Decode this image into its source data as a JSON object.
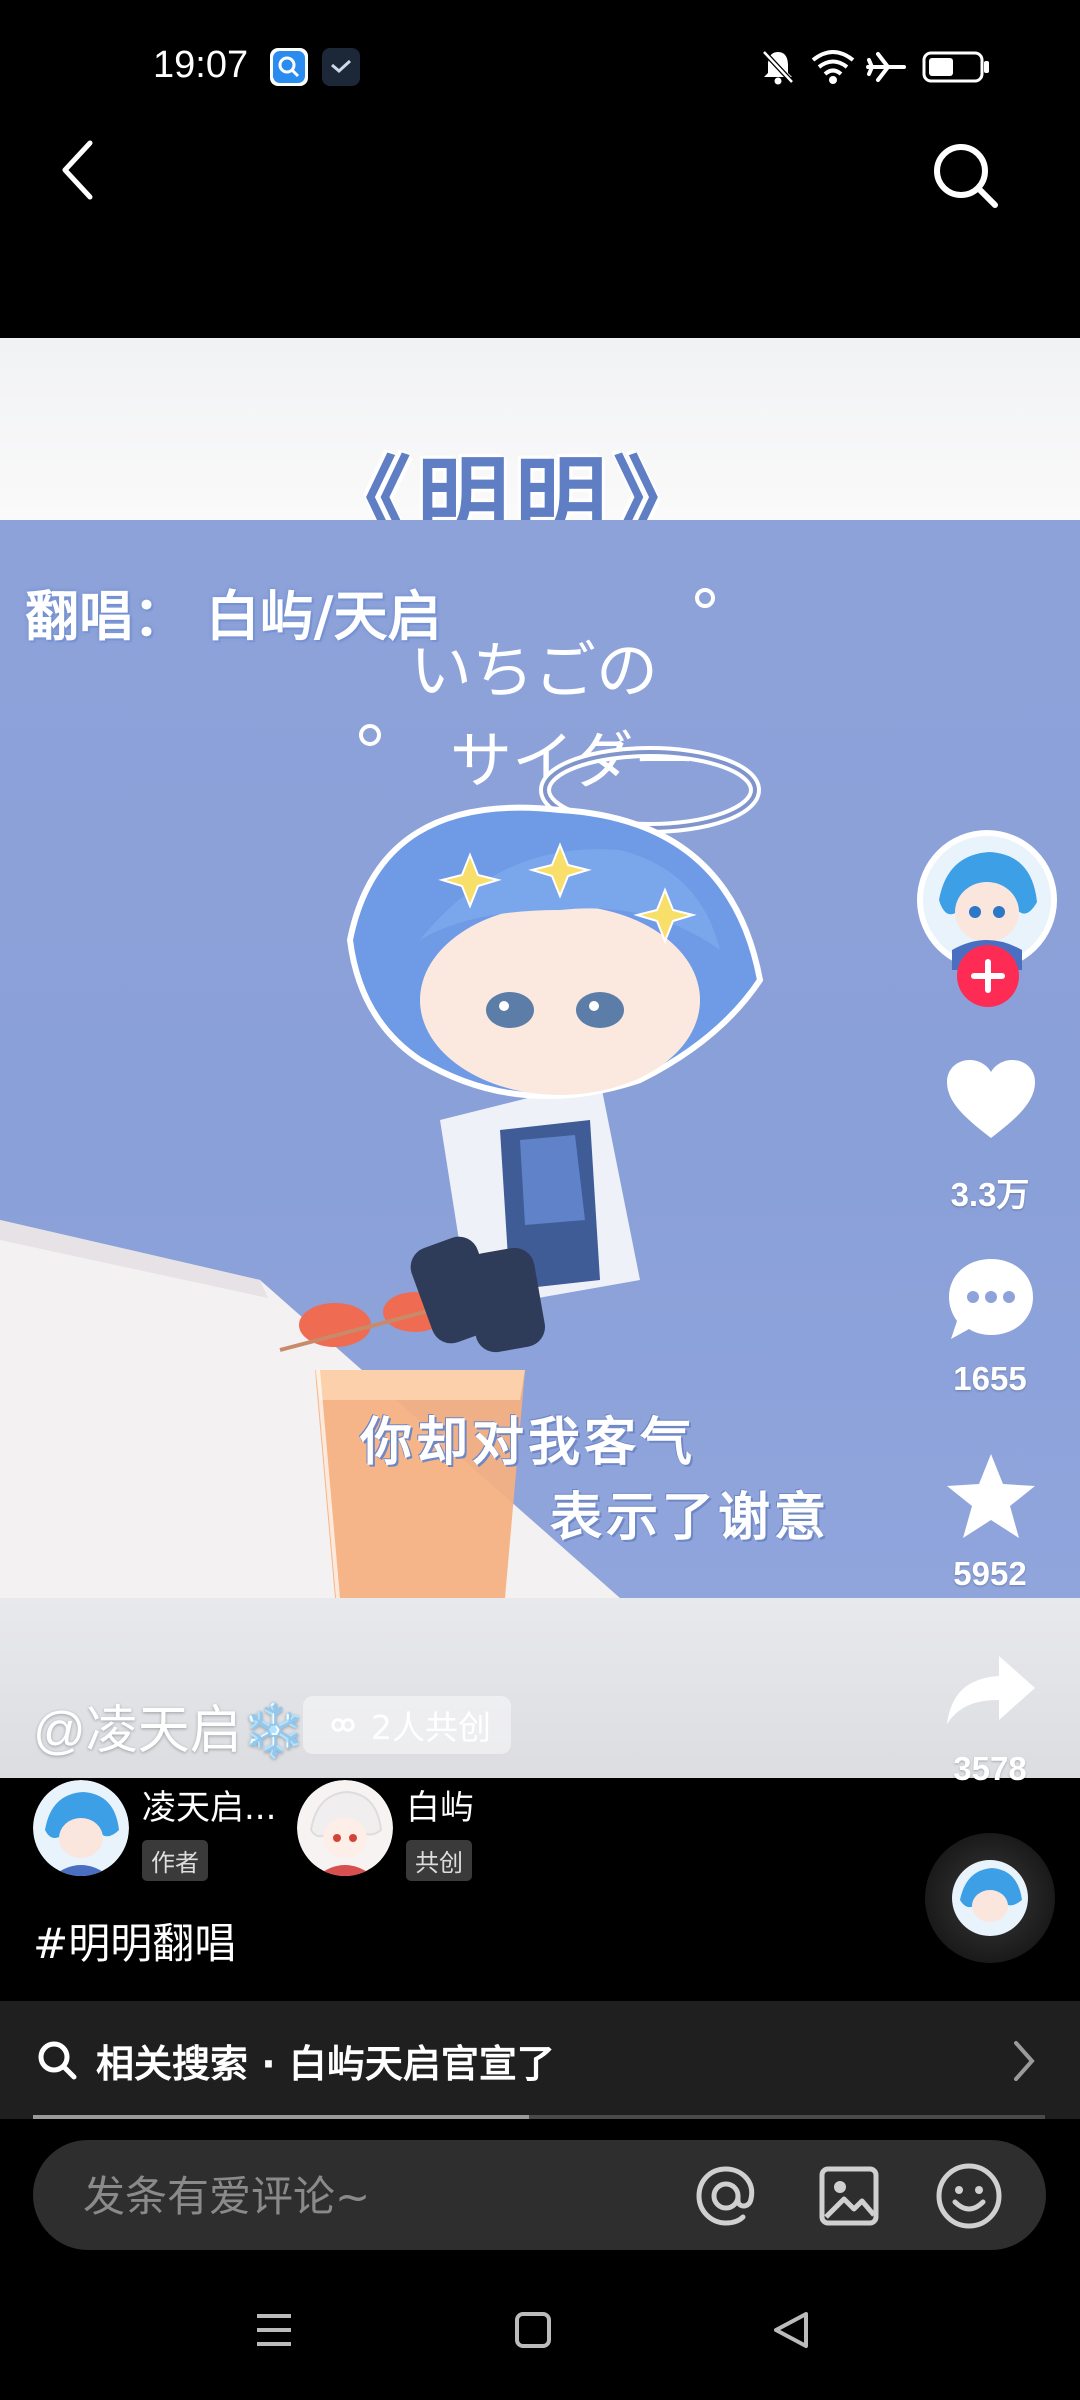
{
  "status_bar": {
    "time": "19:07",
    "icons": [
      "search-app-icon",
      "gallery-app-icon",
      "mute-bell-icon",
      "wifi-icon",
      "airplane-icon",
      "battery-icon"
    ]
  },
  "nav": {
    "back_icon": "chevron-left-icon",
    "search_icon": "search-icon"
  },
  "video": {
    "title": "《明明》",
    "cover_label": "翻唱：  白屿/天启",
    "handwritten_line1": "いちごの",
    "handwritten_line2": "サイダー",
    "lyric_line1": "你却对我客气",
    "lyric_line2": "表示了谢意"
  },
  "rail": {
    "likes": "3.3万",
    "comments": "1655",
    "favorites": "5952",
    "shares": "3578"
  },
  "author": {
    "handle": "@凌天启❄️",
    "cocreate": "2人共创"
  },
  "creators": [
    {
      "name": "凌天启...",
      "role": "作者"
    },
    {
      "name": "白屿",
      "role": "共创"
    }
  ],
  "hashtag": "#明明翻唱",
  "related": {
    "label": "相关搜索 · 白屿天启官宣了",
    "progress": 0.49
  },
  "comment": {
    "placeholder": "发条有爱评论~"
  },
  "colors": {
    "accent": "#fe2c55",
    "video_bg": "#8da2d9",
    "bar_bg": "#2e2e2e"
  }
}
